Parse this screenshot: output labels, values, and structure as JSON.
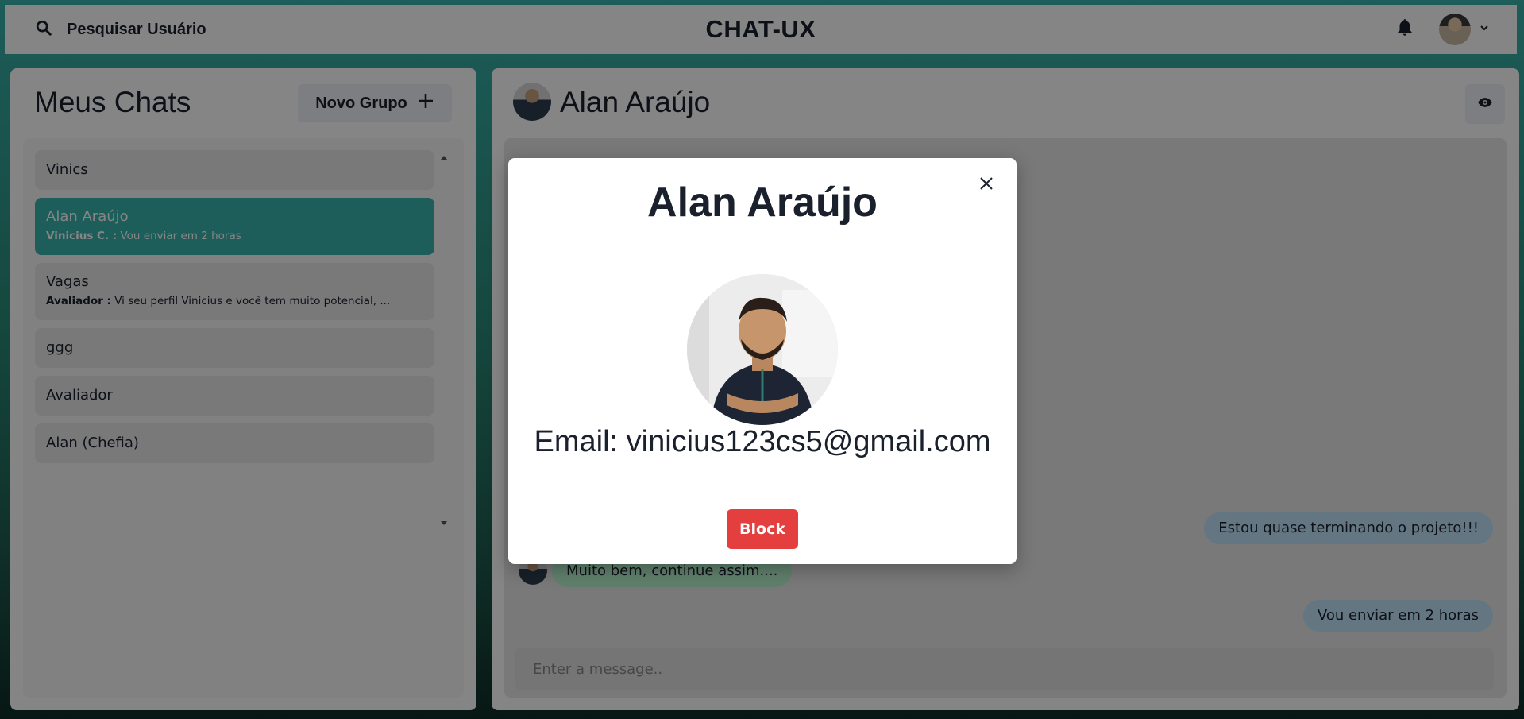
{
  "topbar": {
    "search_label": "Pesquisar Usuário",
    "app_title": "CHAT-UX",
    "icons": [
      "search-icon",
      "bell-icon",
      "chevron-down-icon"
    ]
  },
  "sidebar": {
    "title": "Meus Chats",
    "new_group_label": "Novo Grupo",
    "chats": [
      {
        "name": "Vinics"
      },
      {
        "name": "Alan Araújo",
        "sender": "Vinicius C. :",
        "preview": " Vou enviar em 2 horas",
        "active": true
      },
      {
        "name": "Vagas",
        "sender": "Avaliador :",
        "preview": " Vi seu perfil Vinicius e você tem muito potencial, ..."
      },
      {
        "name": "ggg"
      },
      {
        "name": "Avaliador"
      },
      {
        "name": "Alan (Chefia)"
      }
    ]
  },
  "chat": {
    "header_name": "Alan Araújo",
    "messages": [
      {
        "from": "me",
        "text": "Estou quase terminando o projeto!!!"
      },
      {
        "from": "them",
        "text": "Muito bem, continue assim...."
      },
      {
        "from": "me",
        "text": "Vou enviar em 2 horas"
      }
    ],
    "input_placeholder": "Enter a message.."
  },
  "modal": {
    "title": "Alan Araújo",
    "email_text": "Email: vinicius123cs5@gmail.com",
    "block_label": "Block"
  },
  "colors": {
    "accent": "#38B2AC",
    "block": "#E53E3E",
    "bubble_me": "#BEE3F8",
    "bubble_them": "#B9F5D0"
  }
}
